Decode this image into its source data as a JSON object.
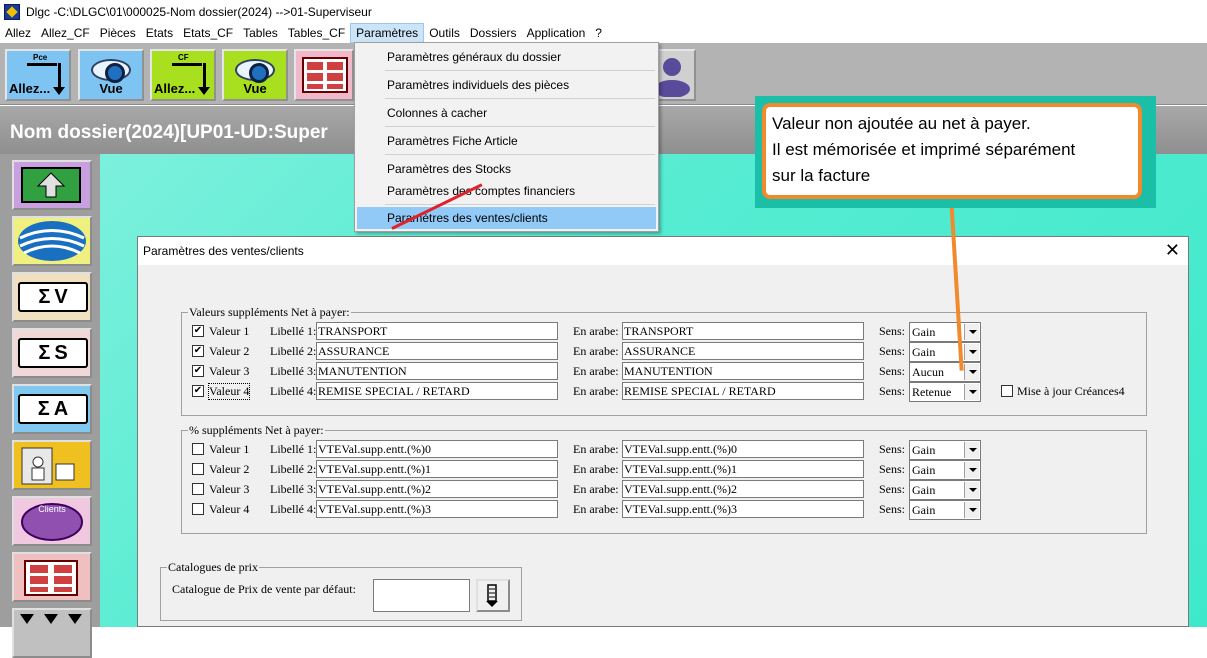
{
  "window": {
    "title": "Dlgc -C:\\DLGC\\01\\000025-Nom dossier(2024) -->01-Superviseur"
  },
  "menubar": [
    "Allez",
    "Allez_CF",
    "Pièces",
    "Etats",
    "Etats_CF",
    "Tables",
    "Tables_CF",
    "Paramètres",
    "Outils",
    "Dossiers",
    "Application",
    "?"
  ],
  "toolbar": {
    "pce_sub": "Pce",
    "allez_label": "Allez...",
    "vue_label": "Vue",
    "cf_sub": "CF",
    "allez_cf_label": "Allez...",
    "vue_cf_label": "Vue"
  },
  "banner": {
    "dossier": "Nom dossier(2024)[UP01-UD:Super"
  },
  "sidebar": {
    "clients_label": "Clients",
    "sigma_v": "V",
    "sigma_s": "S",
    "sigma_a": "A",
    "sigma": "Σ"
  },
  "dropdown": {
    "items": [
      "Paramètres généraux du dossier",
      "Paramètres individuels des pièces",
      "Colonnes à cacher",
      "Paramètres Fiche Article",
      "Paramètres des Stocks",
      "Paramètres des comptes financiers",
      "Paramètres des ventes/clients"
    ]
  },
  "callout": {
    "line1": "Valeur non ajoutée au net à payer.",
    "line2": "Il est mémorisée et imprimé séparément",
    "line3": "sur la facture"
  },
  "dialog": {
    "title": "Paramètres des ventes/clients",
    "close": "✕",
    "group1": {
      "title": "Valeurs suppléments Net à payer:",
      "rows": [
        {
          "check": "Valeur 1",
          "checked": true,
          "lib_label": "Libellé 1:",
          "lib": "TRANSPORT",
          "ar_label": "En arabe:",
          "ar": "TRANSPORT",
          "sens_label": "Sens:",
          "sens": "Gain"
        },
        {
          "check": "Valeur 2",
          "checked": true,
          "lib_label": "Libellé 2:",
          "lib": "ASSURANCE",
          "ar_label": "En arabe:",
          "ar": "ASSURANCE",
          "sens_label": "Sens:",
          "sens": "Gain"
        },
        {
          "check": "Valeur 3",
          "checked": true,
          "lib_label": "Libellé 3:",
          "lib": "MANUTENTION",
          "ar_label": "En arabe:",
          "ar": "MANUTENTION",
          "sens_label": "Sens:",
          "sens": "Aucun"
        },
        {
          "check": "Valeur 4",
          "checked": true,
          "lib_label": "Libellé 4:",
          "lib": "REMISE SPECIAL / RETARD",
          "ar_label": "En arabe:",
          "ar": "REMISE SPECIAL / RETARD",
          "sens_label": "Sens:",
          "sens": "Retenue"
        }
      ],
      "maj_label": "Mise à jour Créances4"
    },
    "group2": {
      "title": "% suppléments Net à payer:",
      "rows": [
        {
          "check": "Valeur 1",
          "checked": false,
          "lib_label": "Libellé 1:",
          "lib": "VTEVal.supp.entt.(%)0",
          "ar_label": "En arabe:",
          "ar": "VTEVal.supp.entt.(%)0",
          "sens_label": "Sens:",
          "sens": "Gain"
        },
        {
          "check": "Valeur 2",
          "checked": false,
          "lib_label": "Libellé 2:",
          "lib": "VTEVal.supp.entt.(%)1",
          "ar_label": "En arabe:",
          "ar": "VTEVal.supp.entt.(%)1",
          "sens_label": "Sens:",
          "sens": "Gain"
        },
        {
          "check": "Valeur 3",
          "checked": false,
          "lib_label": "Libellé 3:",
          "lib": "VTEVal.supp.entt.(%)2",
          "ar_label": "En arabe:",
          "ar": "VTEVal.supp.entt.(%)2",
          "sens_label": "Sens:",
          "sens": "Gain"
        },
        {
          "check": "Valeur 4",
          "checked": false,
          "lib_label": "Libellé 4:",
          "lib": "VTEVal.supp.entt.(%)3",
          "ar_label": "En arabe:",
          "ar": "VTEVal.supp.entt.(%)3",
          "sens_label": "Sens:",
          "sens": "Gain"
        }
      ]
    },
    "group3": {
      "title": "Catalogues de prix",
      "label": "Catalogue de Prix de vente par défaut:",
      "value": ""
    }
  }
}
